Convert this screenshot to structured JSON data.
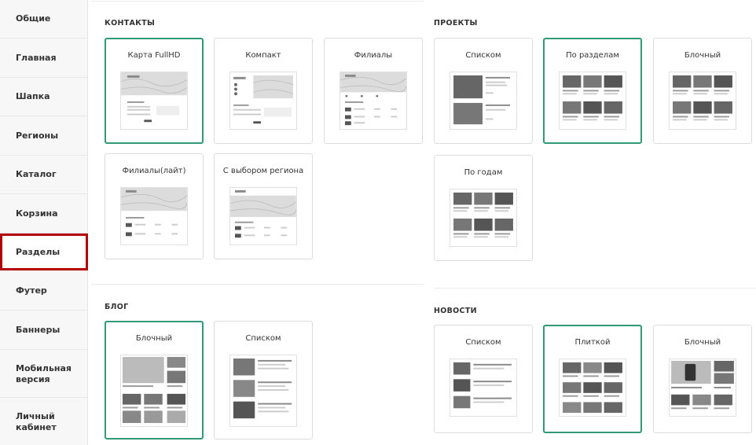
{
  "sidebar": {
    "items": [
      {
        "label": "Общие"
      },
      {
        "label": "Главная"
      },
      {
        "label": "Шапка"
      },
      {
        "label": "Регионы"
      },
      {
        "label": "Каталог"
      },
      {
        "label": "Корзина"
      },
      {
        "label": "Разделы",
        "active": true
      },
      {
        "label": "Футер"
      },
      {
        "label": "Баннеры"
      },
      {
        "label": "Мобильная версия"
      },
      {
        "label": "Личный кабинет"
      }
    ]
  },
  "sections": {
    "contacts": {
      "title": "КОНТАКТЫ",
      "options": [
        {
          "label": "Карта FullHD",
          "selected": true
        },
        {
          "label": "Компакт",
          "selected": false
        },
        {
          "label": "Филиалы",
          "selected": false
        },
        {
          "label": "Филиалы(лайт)",
          "selected": false
        },
        {
          "label": "С выбором региона",
          "selected": false
        }
      ]
    },
    "projects": {
      "title": "ПРОЕКТЫ",
      "options": [
        {
          "label": "Списком",
          "selected": false
        },
        {
          "label": "По разделам",
          "selected": true
        },
        {
          "label": "Блочный",
          "selected": false
        },
        {
          "label": "По годам",
          "selected": false
        }
      ]
    },
    "blog": {
      "title": "БЛОГ",
      "options": [
        {
          "label": "Блочный",
          "selected": true
        },
        {
          "label": "Списком",
          "selected": false
        }
      ]
    },
    "news": {
      "title": "НОВОСТИ",
      "options": [
        {
          "label": "Списком",
          "selected": false
        },
        {
          "label": "Плиткой",
          "selected": true
        },
        {
          "label": "Блочный",
          "selected": false
        }
      ]
    }
  },
  "colors": {
    "selected_border": "#2e9a76",
    "active_sidebar_border": "#b30000"
  }
}
